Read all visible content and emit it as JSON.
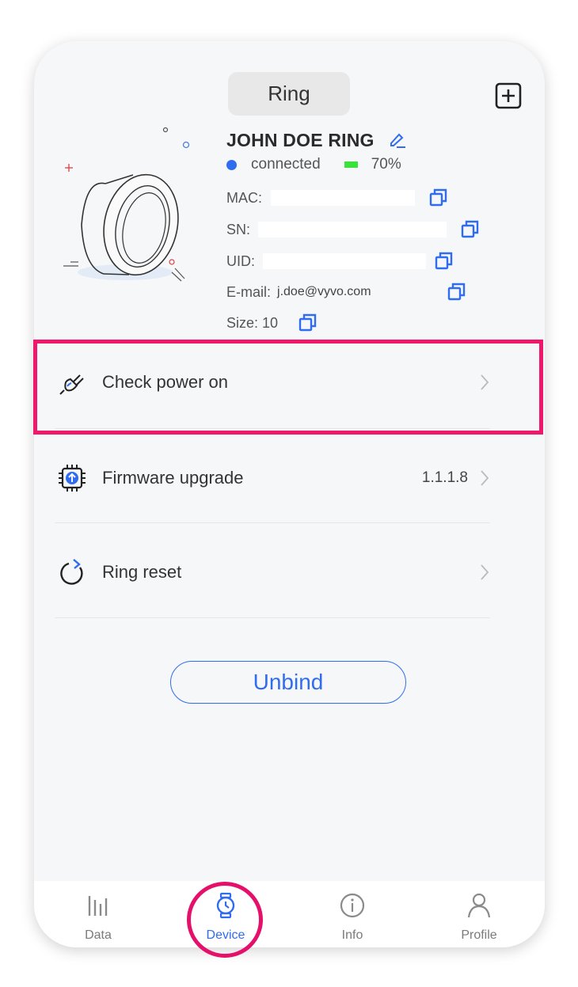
{
  "header": {
    "tab_label": "Ring"
  },
  "device": {
    "name": "JOHN  DOE RING",
    "status": "connected",
    "battery": "70%",
    "battery_level": 0.7,
    "mac_label": "MAC:",
    "sn_label": "SN:",
    "uid_label": "UID:",
    "email_label": "E-mail:",
    "email_value": "j.doe@vyvo.com",
    "size_label": "Size: 10"
  },
  "menu": {
    "check_power": {
      "label": "Check power on"
    },
    "firmware": {
      "label": "Firmware upgrade",
      "version": "1.1.1.8"
    },
    "reset": {
      "label": "Ring reset"
    }
  },
  "unbind_label": "Unbind",
  "nav": {
    "items": [
      {
        "label": "Data",
        "icon": "bars-icon"
      },
      {
        "label": "Device",
        "icon": "watch-icon"
      },
      {
        "label": "Info",
        "icon": "info-icon"
      },
      {
        "label": "Profile",
        "icon": "person-icon"
      }
    ],
    "active": "Device"
  },
  "colors": {
    "accent": "#2f6cf0",
    "battery": "#3be23b",
    "highlight": "#f0186b"
  }
}
